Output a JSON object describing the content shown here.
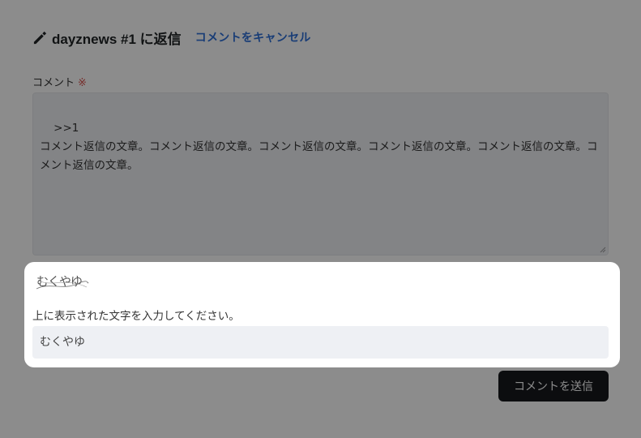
{
  "reply": {
    "title": "dayznews #1 に返信",
    "cancel_label": "コメントをキャンセル"
  },
  "comment": {
    "label": "コメント",
    "required_mark": "※",
    "value": ">>1\nコメント返信の文章。コメント返信の文章。コメント返信の文章。コメント返信の文章。コメント返信の文章。コメント返信の文章。"
  },
  "submit": {
    "label": "コメントを送信"
  },
  "captcha": {
    "image_text": "むくやゆ",
    "instruction": "上に表示された文字を入力してください。",
    "input_value": "むくやゆ"
  },
  "colors": {
    "accent": "#2e6fd8",
    "required": "#d9534f",
    "button_bg": "#17191c",
    "field_bg": "#eef0f4"
  },
  "icons": {
    "reply": "pencil-icon"
  }
}
